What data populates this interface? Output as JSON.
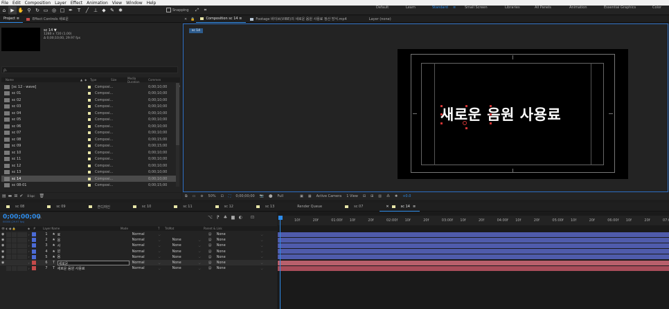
{
  "menu": [
    "File",
    "Edit",
    "Composition",
    "Layer",
    "Effect",
    "Animation",
    "View",
    "Window",
    "Help"
  ],
  "toolbar": {
    "snapping_label": "Snapping",
    "workspaces": [
      {
        "label": "Default",
        "active": false
      },
      {
        "label": "Learn",
        "active": false
      },
      {
        "label": "Standard",
        "active": true
      },
      {
        "label": "Small Screen",
        "active": false
      },
      {
        "label": "Libraries",
        "active": false
      },
      {
        "label": "All Panels",
        "active": false
      },
      {
        "label": "Animation",
        "active": false
      },
      {
        "label": "Essential Graphics",
        "active": false
      },
      {
        "label": "Color",
        "active": false
      }
    ]
  },
  "project": {
    "tab_project": "Project",
    "tab_effect_controls": "Effect Controls 새로운",
    "comp_name": "sc 14 ▼",
    "comp_res": "1280 x 720 (1.00)",
    "comp_dur": "Δ 0;00;10;00, 29.97 fps",
    "search_icon_glyph": "ρ.",
    "columns": [
      "Name",
      "Type",
      "Size",
      "Media Duration",
      "Commen"
    ],
    "items": [
      {
        "name": "[sc 12 - wave]",
        "type": "Composi...",
        "duration": "0;00;10;00"
      },
      {
        "name": "sc 01",
        "type": "Composi...",
        "duration": "0;00;10;00"
      },
      {
        "name": "sc 02",
        "type": "Composi...",
        "duration": "0;00;10;00"
      },
      {
        "name": "sc 03",
        "type": "Composi...",
        "duration": "0;00;10;00"
      },
      {
        "name": "sc 04",
        "type": "Composi...",
        "duration": "0;00;10;00"
      },
      {
        "name": "sc 05",
        "type": "Composi...",
        "duration": "0;00;10;00"
      },
      {
        "name": "sc 06",
        "type": "Composi...",
        "duration": "0;00;10;00"
      },
      {
        "name": "sc 07",
        "type": "Composi...",
        "duration": "0;00;10;00"
      },
      {
        "name": "sc 08",
        "type": "Composi...",
        "duration": "0;00;15;00"
      },
      {
        "name": "sc 09",
        "type": "Composi...",
        "duration": "0;00;15;00"
      },
      {
        "name": "sc 10",
        "type": "Composi...",
        "duration": "0;00;10;00"
      },
      {
        "name": "sc 11",
        "type": "Composi...",
        "duration": "0;00;10;00"
      },
      {
        "name": "sc 12",
        "type": "Composi...",
        "duration": "0;00;10;00"
      },
      {
        "name": "sc 13",
        "type": "Composi...",
        "duration": "0;00;10;00"
      },
      {
        "name": "sc 14",
        "type": "Composi...",
        "duration": "0;00;10;00",
        "selected": true
      },
      {
        "name": "sc 08-01",
        "type": "Composi...",
        "duration": "0;00;15;00"
      }
    ],
    "bpc": "8 bpc"
  },
  "viewer": {
    "tab_composition": "Composition sc 14",
    "tab_footage": "Footage 바이브(VIBE)의 새로운 음원 사용료 정산 방식.mp4",
    "tab_layer": "Layer (none)",
    "breadcrumb": "sc 14",
    "overlay_text": "새로운 음원 사용료",
    "zoom": "50%",
    "timecode": "0;00;00;00",
    "resolution": "Full",
    "camera": "Active Camera",
    "view": "1 View",
    "exposure": "+0.0"
  },
  "timeline": {
    "tabs": [
      {
        "label": "sc 08",
        "color": "#e8e6a8"
      },
      {
        "label": "sc 09",
        "color": "#e8e6a8"
      },
      {
        "label": "흔디자인",
        "color": "#e8e6a8"
      },
      {
        "label": "sc 10",
        "color": "#e8e6a8"
      },
      {
        "label": "sc 11",
        "color": "#e8e6a8"
      },
      {
        "label": "sc 12",
        "color": "#e8e6a8"
      },
      {
        "label": "sc 13",
        "color": "#e8e6a8"
      },
      {
        "label": "Render Queue",
        "color": ""
      },
      {
        "label": "sc 07",
        "color": "#e8e6a8"
      },
      {
        "label": "sc 14",
        "color": "#e8e6a8",
        "active": true
      }
    ],
    "current_time": "0;00;00;00",
    "current_frame": "00000 (29.97 fps)",
    "columns": {
      "layer_name": "Layer Name",
      "mode": "Mode",
      "t": "T",
      "trkmat": "TrkMat",
      "parent": "Parent & Link"
    },
    "layers": [
      {
        "num": "1",
        "type": "★",
        "name": "료",
        "mode": "Normal",
        "trkmat": "",
        "parent": "None",
        "color": "#4b6bd6"
      },
      {
        "num": "2",
        "type": "★",
        "name": "용",
        "mode": "Normal",
        "trkmat": "None",
        "parent": "None",
        "color": "#4b6bd6"
      },
      {
        "num": "3",
        "type": "★",
        "name": "사",
        "mode": "Normal",
        "trkmat": "None",
        "parent": "None",
        "color": "#4b6bd6"
      },
      {
        "num": "4",
        "type": "★",
        "name": "원",
        "mode": "Normal",
        "trkmat": "None",
        "parent": "None",
        "color": "#4b6bd6"
      },
      {
        "num": "5",
        "type": "★",
        "name": "음",
        "mode": "Normal",
        "trkmat": "None",
        "parent": "None",
        "color": "#4b6bd6"
      },
      {
        "num": "6",
        "type": "T",
        "name": "새로운",
        "mode": "Normal",
        "trkmat": "None",
        "parent": "None",
        "color": "#c44a4a",
        "editing": true
      },
      {
        "num": "7",
        "type": "T",
        "name": "새로운 음원 사용료",
        "mode": "Normal",
        "trkmat": "None",
        "parent": "None",
        "color": "#c44a4a"
      }
    ],
    "ruler_ticks": [
      "10f",
      "20f",
      "01:00f",
      "10f",
      "20f",
      "02:00f",
      "10f",
      "20f",
      "03:00f",
      "10f",
      "20f",
      "04:00f",
      "10f",
      "20f",
      "05:00f",
      "10f",
      "20f",
      "06:00f",
      "10f",
      "20f",
      "07:0"
    ]
  }
}
